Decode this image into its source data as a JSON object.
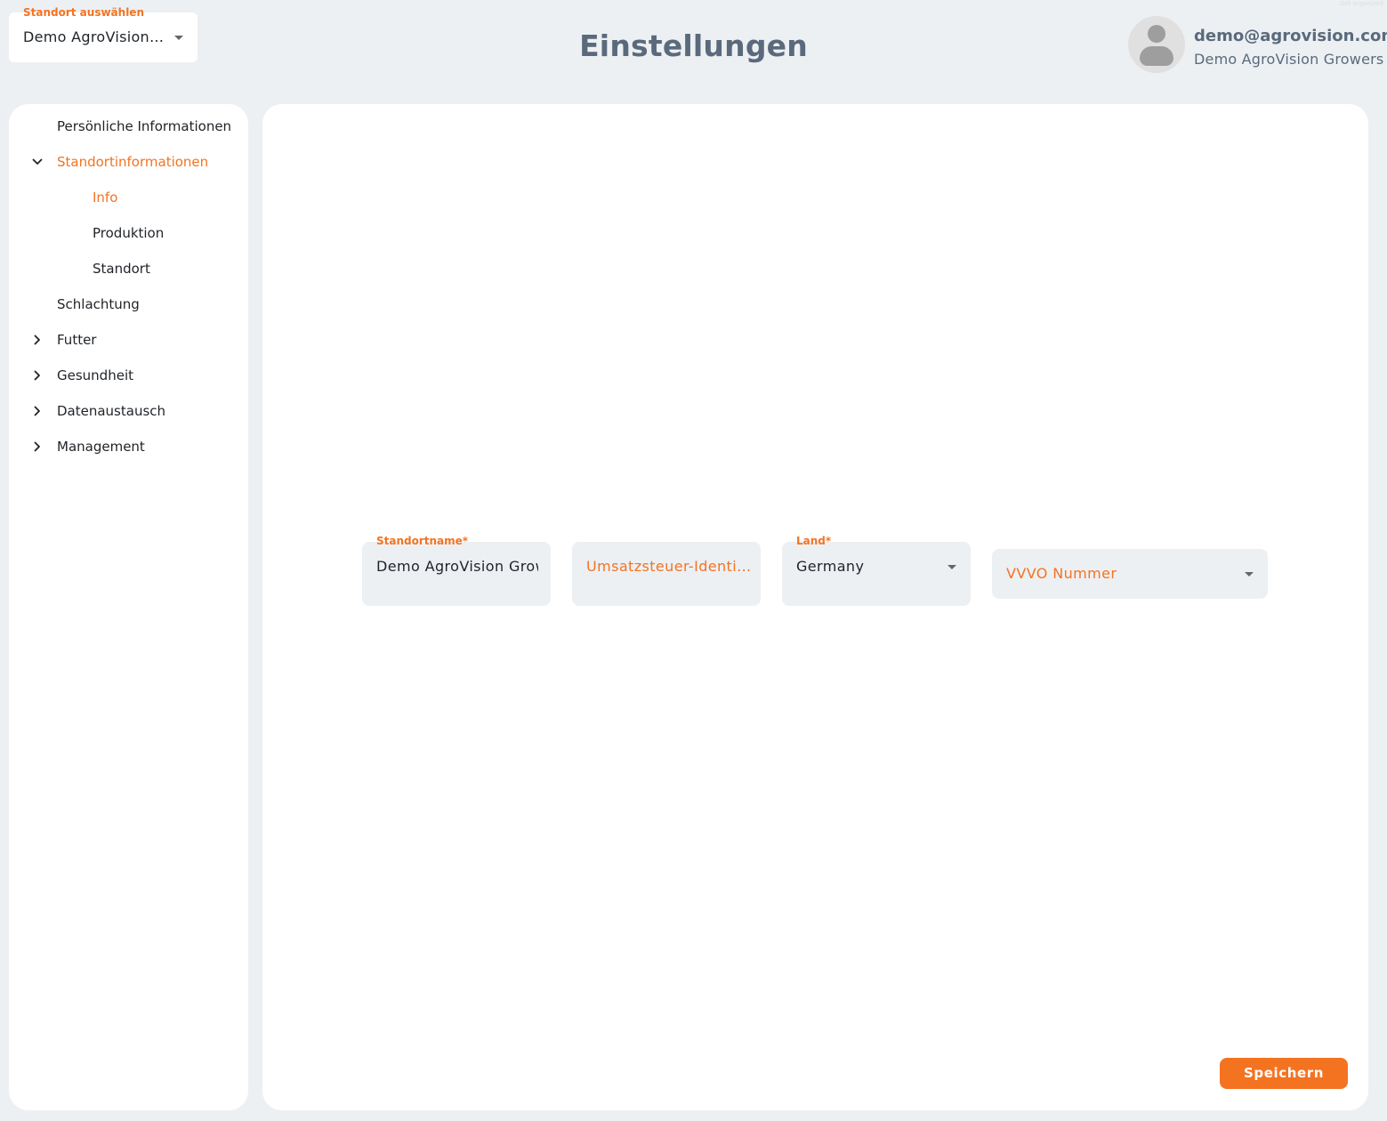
{
  "header": {
    "location_selector": {
      "label": "Standort auswählen",
      "value": "Demo AgroVision Growers",
      "display_value": "Demo AgroVision ..."
    },
    "title": "Einstellungen",
    "user": {
      "email": "demo@agrovision.com",
      "organization": "Demo AgroVision Growers",
      "avatar_icon": "person-icon"
    },
    "corner_note": "Get organized"
  },
  "sidebar": {
    "items": [
      {
        "label": "Persönliche Informationen",
        "level": 0,
        "chevron": "none",
        "active": false
      },
      {
        "label": "Standortinformationen",
        "level": 0,
        "chevron": "expanded",
        "active": true
      },
      {
        "label": "Info",
        "level": 1,
        "chevron": "none",
        "active": true
      },
      {
        "label": "Produktion",
        "level": 1,
        "chevron": "none",
        "active": false
      },
      {
        "label": "Standort",
        "level": 1,
        "chevron": "none",
        "active": false
      },
      {
        "label": "Schlachtung",
        "level": 0,
        "chevron": "none",
        "active": false
      },
      {
        "label": "Futter",
        "level": 0,
        "chevron": "collapsed",
        "active": false
      },
      {
        "label": "Gesundheit",
        "level": 0,
        "chevron": "collapsed",
        "active": false
      },
      {
        "label": "Datenaustausch",
        "level": 0,
        "chevron": "collapsed",
        "active": false
      },
      {
        "label": "Management",
        "level": 0,
        "chevron": "collapsed",
        "active": false
      }
    ]
  },
  "form": {
    "standortname": {
      "label": "Standortname*",
      "value": "Demo AgroVision Growers"
    },
    "ust_id": {
      "placeholder": "Umsatzsteuer-Identifikationsnummer",
      "display_placeholder": "Umsatzsteuer-Identif..."
    },
    "land": {
      "label": "Land*",
      "value": "Germany"
    },
    "vvvo": {
      "placeholder": "VVVO Nummer"
    }
  },
  "actions": {
    "save_label": "Speichern"
  },
  "colors": {
    "accent": "#f47321",
    "title": "#5a6a7c",
    "background": "#edf0f3",
    "panel": "#ffffff"
  }
}
